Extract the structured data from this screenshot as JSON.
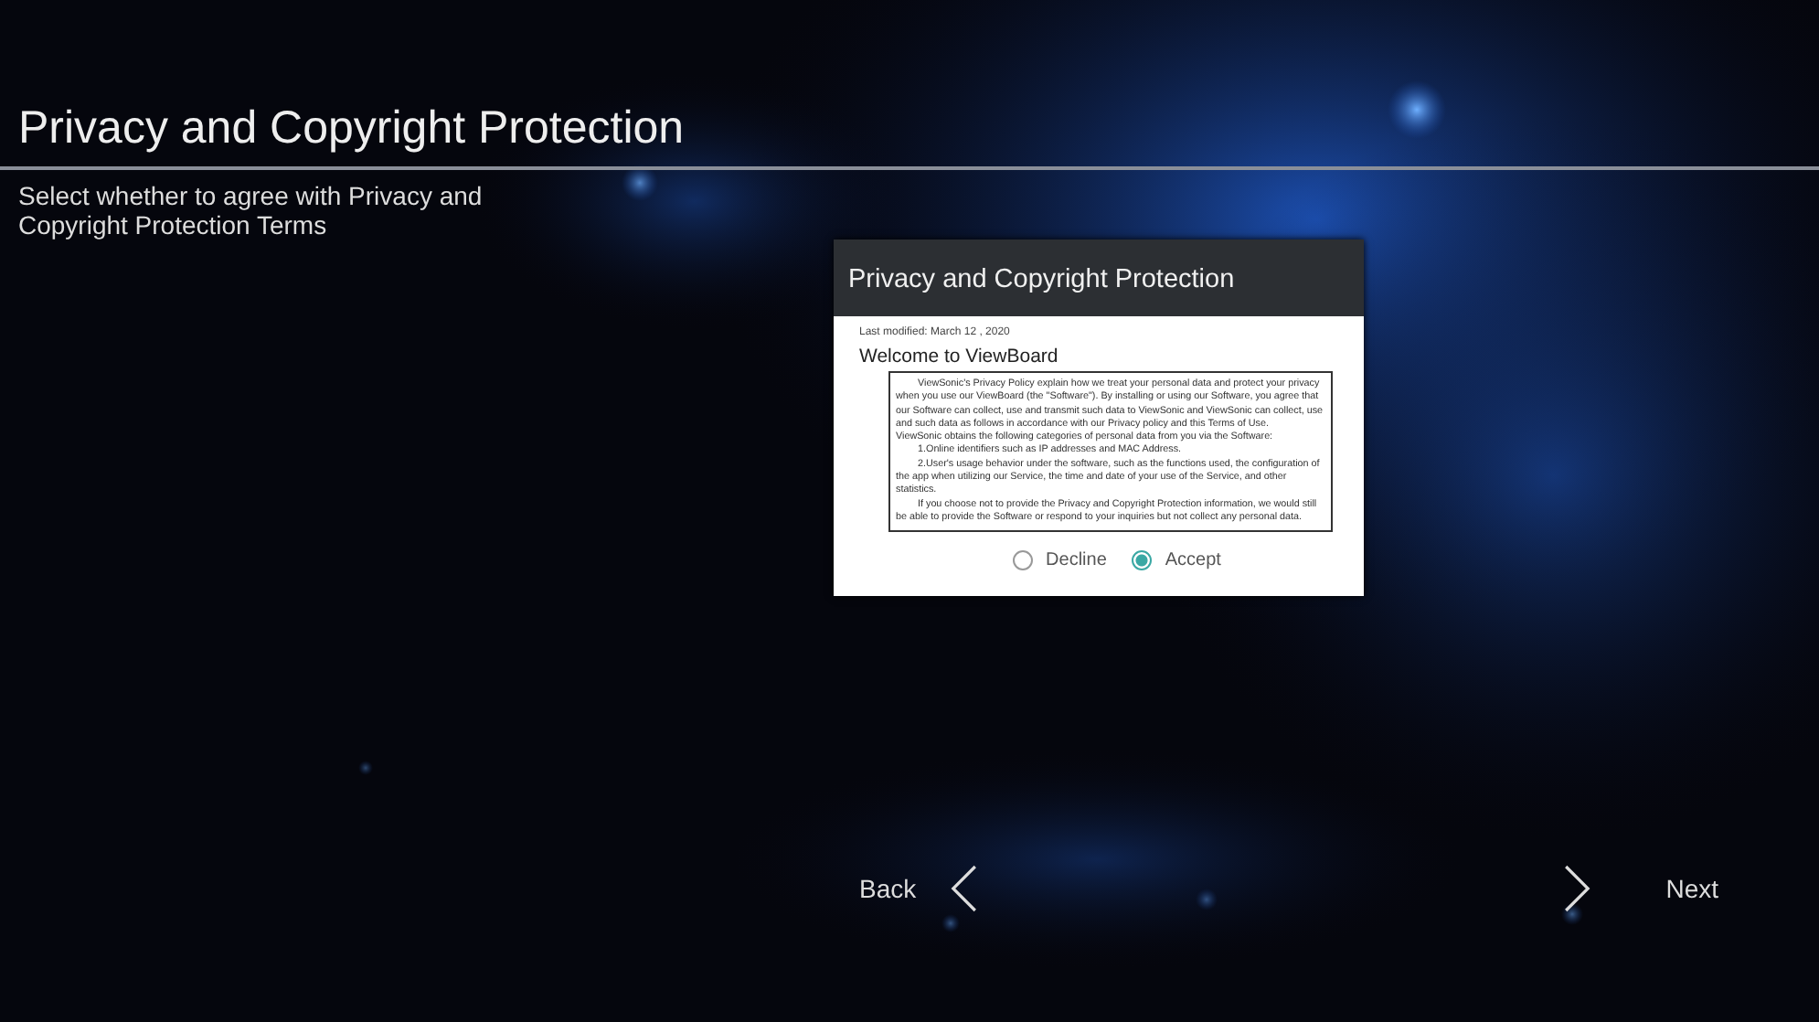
{
  "header": {
    "title": "Privacy and Copyright Protection",
    "subtitle": "Select whether to agree with Privacy and Copyright Protection Terms"
  },
  "dialog": {
    "title": "Privacy and Copyright Protection",
    "last_modified": "Last modified: March 12 , 2020",
    "heading": "Welcome to ViewBoard",
    "paragraphs": [
      {
        "text": "ViewSonic's Privacy Policy explain how we treat your personal data and protect your privacy when you use our ViewBoard (the \"Software\"). By installing or using our Software, you agree that our Software can collect, use and transmit such data to ViewSonic and ViewSonic can collect, use and such data as follows in accordance with our Privacy policy and this Terms of Use.",
        "indent": true
      },
      {
        "text": "ViewSonic obtains the following categories of personal data from you via the Software:",
        "indent": false
      },
      {
        "text": "1.Online identifiers such as IP addresses and MAC Address.",
        "indent": true
      },
      {
        "text": "2.User's usage behavior under the software, such as the functions used, the configuration of the app when utilizing our Service, the time and date of your use of the Service, and other statistics.",
        "indent": true
      },
      {
        "text": "If you choose not to provide the Privacy and Copyright Protection information, we would still be able to provide the Software or respond to your inquiries but not collect any personal data.",
        "indent": true
      }
    ],
    "options": [
      {
        "label": "Decline",
        "selected": false
      },
      {
        "label": "Accept",
        "selected": true
      }
    ]
  },
  "nav": {
    "back": "Back",
    "next": "Next"
  }
}
